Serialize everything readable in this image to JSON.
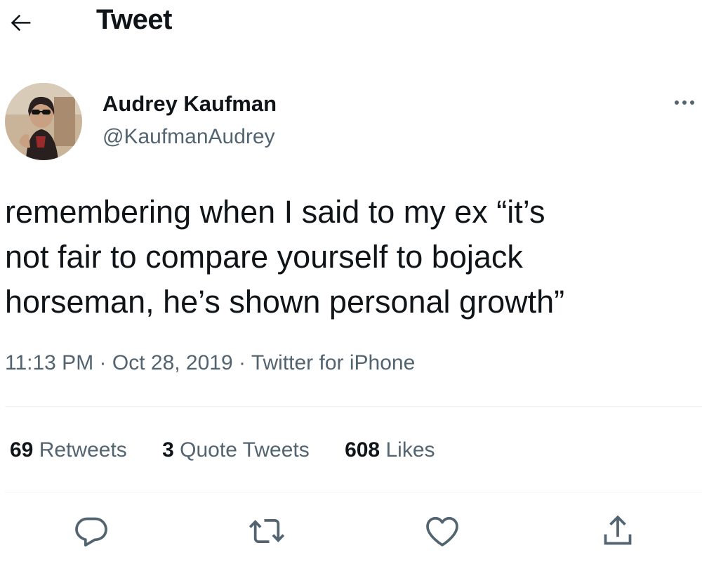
{
  "header": {
    "title": "Tweet",
    "back_icon": "arrow-left-icon"
  },
  "author": {
    "display_name": "Audrey Kaufman",
    "handle": "@KaufmanAudrey",
    "more_icon": "more-horizontal-icon"
  },
  "tweet": {
    "lines": [
      "remembering when I said to my ex “it’s",
      "not fair to compare yourself to bojack",
      "horseman, he’s shown personal growth”"
    ],
    "time": "11:13 PM",
    "date": "Oct 28, 2019",
    "separator": "·",
    "source": "Twitter for iPhone"
  },
  "stats": {
    "retweets": {
      "count": "69",
      "label": "Retweets"
    },
    "quotes": {
      "count": "3",
      "label": "Quote Tweets"
    },
    "likes": {
      "count": "608",
      "label": "Likes"
    }
  },
  "actions": [
    "reply-icon",
    "retweet-icon",
    "like-icon",
    "share-icon"
  ],
  "colors": {
    "text": "#0f1419",
    "secondary": "#536471",
    "divider": "#eff3f4"
  }
}
